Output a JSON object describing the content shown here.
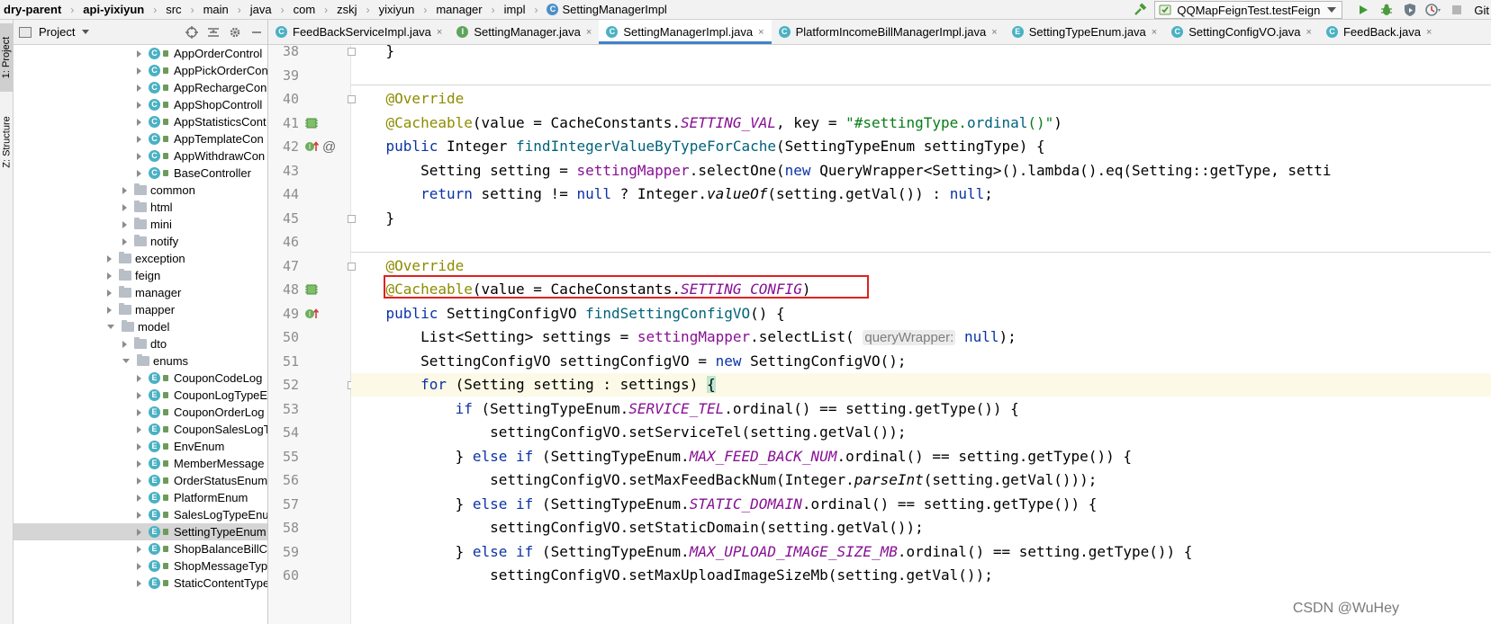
{
  "navbar": {
    "breadcrumbs": [
      "dry-parent",
      "api-yixiyun",
      "src",
      "main",
      "java",
      "com",
      "zskj",
      "yixiyun",
      "manager",
      "impl",
      "SettingManagerImpl"
    ],
    "run_config": "QQMapFeignTest.testFeign",
    "vcs_label": "Git"
  },
  "left_strip": {
    "project_tab": "1: Project",
    "structure_tab": "Z: Structure"
  },
  "project_panel": {
    "title": "Project",
    "tree": [
      {
        "label": "AppOrderControl",
        "type": "class",
        "depth": 3
      },
      {
        "label": "AppPickOrderCon",
        "type": "class",
        "depth": 3
      },
      {
        "label": "AppRechargeCon",
        "type": "class",
        "depth": 3
      },
      {
        "label": "AppShopControll",
        "type": "class",
        "depth": 3
      },
      {
        "label": "AppStatisticsCont",
        "type": "class",
        "depth": 3
      },
      {
        "label": "AppTemplateCon",
        "type": "class",
        "depth": 3
      },
      {
        "label": "AppWithdrawCon",
        "type": "class",
        "depth": 3
      },
      {
        "label": "BaseController",
        "type": "class",
        "depth": 3
      },
      {
        "label": "common",
        "type": "folder",
        "depth": 2
      },
      {
        "label": "html",
        "type": "folder",
        "depth": 2
      },
      {
        "label": "mini",
        "type": "folder",
        "depth": 2
      },
      {
        "label": "notify",
        "type": "folder",
        "depth": 2
      },
      {
        "label": "exception",
        "type": "folder",
        "depth": 1
      },
      {
        "label": "feign",
        "type": "folder",
        "depth": 1
      },
      {
        "label": "manager",
        "type": "folder",
        "depth": 1
      },
      {
        "label": "mapper",
        "type": "folder",
        "depth": 1
      },
      {
        "label": "model",
        "type": "folder-open",
        "depth": 1
      },
      {
        "label": "dto",
        "type": "folder",
        "depth": 2
      },
      {
        "label": "enums",
        "type": "folder-open",
        "depth": 2
      },
      {
        "label": "CouponCodeLog",
        "type": "enum",
        "depth": 3
      },
      {
        "label": "CouponLogTypeE",
        "type": "enum",
        "depth": 3
      },
      {
        "label": "CouponOrderLog",
        "type": "enum",
        "depth": 3
      },
      {
        "label": "CouponSalesLogT",
        "type": "enum",
        "depth": 3
      },
      {
        "label": "EnvEnum",
        "type": "enum",
        "depth": 3
      },
      {
        "label": "MemberMessage",
        "type": "enum",
        "depth": 3
      },
      {
        "label": "OrderStatusEnum",
        "type": "enum",
        "depth": 3
      },
      {
        "label": "PlatformEnum",
        "type": "enum",
        "depth": 3
      },
      {
        "label": "SalesLogTypeEnu",
        "type": "enum",
        "depth": 3
      },
      {
        "label": "SettingTypeEnum",
        "type": "enum",
        "depth": 3,
        "selected": true
      },
      {
        "label": "ShopBalanceBillC",
        "type": "enum",
        "depth": 3
      },
      {
        "label": "ShopMessageTyp",
        "type": "enum",
        "depth": 3
      },
      {
        "label": "StaticContentType",
        "type": "enum",
        "depth": 3
      }
    ]
  },
  "tabs": [
    {
      "label": "FeedBackServiceImpl.java",
      "icon": "c"
    },
    {
      "label": "SettingManager.java",
      "icon": "i"
    },
    {
      "label": "SettingManagerImpl.java",
      "icon": "c",
      "active": true
    },
    {
      "label": "PlatformIncomeBillManagerImpl.java",
      "icon": "c"
    },
    {
      "label": "SettingTypeEnum.java",
      "icon": "e"
    },
    {
      "label": "SettingConfigVO.java",
      "icon": "c"
    },
    {
      "label": "FeedBack.java",
      "icon": "c"
    }
  ],
  "editor": {
    "first_line": 38,
    "current_line": 52,
    "highlighted_line": 48,
    "lines": [
      [
        [
          "    }",
          ""
        ]
      ],
      [
        [
          "",
          ""
        ]
      ],
      [
        [
          "    ",
          ""
        ],
        [
          "@Override",
          "anno"
        ]
      ],
      [
        [
          "    ",
          ""
        ],
        [
          "@Cacheable",
          "anno"
        ],
        [
          "(value = CacheConstants.",
          ""
        ],
        [
          "SETTING_VAL",
          "field"
        ],
        [
          ", key = ",
          ""
        ],
        [
          "\"#settingType.",
          "str"
        ],
        [
          "ordinal",
          "method"
        ],
        [
          "()\"",
          "str"
        ],
        [
          ")",
          ""
        ]
      ],
      [
        [
          "    ",
          ""
        ],
        [
          "public",
          "kw"
        ],
        [
          " Integer ",
          ""
        ],
        [
          "findIntegerValueByTypeForCache",
          "method"
        ],
        [
          "(SettingTypeEnum settingType) {",
          ""
        ]
      ],
      [
        [
          "        Setting setting = ",
          ""
        ],
        [
          "settingMapper",
          "mfield"
        ],
        [
          ".selectOne(",
          ""
        ],
        [
          "new",
          "kw"
        ],
        [
          " QueryWrapper<Setting>().lambda().eq(Setting::getType, setti",
          ""
        ]
      ],
      [
        [
          "        ",
          ""
        ],
        [
          "return",
          "kw"
        ],
        [
          " setting != ",
          ""
        ],
        [
          "null",
          "kw"
        ],
        [
          " ? Integer.",
          ""
        ],
        [
          "valueOf",
          "italic"
        ],
        [
          "(setting.getVal()) : ",
          ""
        ],
        [
          "null",
          "kw"
        ],
        [
          ";",
          ""
        ]
      ],
      [
        [
          "    }",
          ""
        ]
      ],
      [
        [
          "",
          ""
        ]
      ],
      [
        [
          "    ",
          ""
        ],
        [
          "@Override",
          "anno"
        ]
      ],
      [
        [
          "    ",
          ""
        ],
        [
          "@Cacheable",
          "anno"
        ],
        [
          "(value = CacheConstants.",
          ""
        ],
        [
          "SETTING_CONFIG",
          "field"
        ],
        [
          ")",
          ""
        ]
      ],
      [
        [
          "    ",
          ""
        ],
        [
          "public",
          "kw"
        ],
        [
          " SettingConfigVO ",
          ""
        ],
        [
          "findSettingConfigVO",
          "method"
        ],
        [
          "() {",
          ""
        ]
      ],
      [
        [
          "        List<Setting> settings = ",
          ""
        ],
        [
          "settingMapper",
          "mfield"
        ],
        [
          ".selectList( ",
          ""
        ],
        [
          "queryWrapper:",
          "hint"
        ],
        [
          " ",
          ""
        ],
        [
          "null",
          "kw"
        ],
        [
          ");",
          ""
        ]
      ],
      [
        [
          "        SettingConfigVO settingConfigVO = ",
          ""
        ],
        [
          "new",
          "kw"
        ],
        [
          " SettingConfigVO();",
          ""
        ]
      ],
      [
        [
          "        ",
          ""
        ],
        [
          "for",
          "kw"
        ],
        [
          " (Setting setting : settings) ",
          ""
        ],
        [
          "{",
          "brace-hl"
        ]
      ],
      [
        [
          "            ",
          ""
        ],
        [
          "if",
          "kw"
        ],
        [
          " (SettingTypeEnum.",
          ""
        ],
        [
          "SERVICE_TEL",
          "field"
        ],
        [
          ".ordinal() == setting.getType()) {",
          ""
        ]
      ],
      [
        [
          "                settingConfigVO.setServiceTel(setting.getVal());",
          ""
        ]
      ],
      [
        [
          "            } ",
          ""
        ],
        [
          "else if",
          "kw"
        ],
        [
          " (SettingTypeEnum.",
          ""
        ],
        [
          "MAX_FEED_BACK_NUM",
          "field"
        ],
        [
          ".ordinal() == setting.getType()) {",
          ""
        ]
      ],
      [
        [
          "                settingConfigVO.setMaxFeedBackNum(Integer.",
          ""
        ],
        [
          "parseInt",
          "italic"
        ],
        [
          "(setting.getVal()));",
          ""
        ]
      ],
      [
        [
          "            } ",
          ""
        ],
        [
          "else if",
          "kw"
        ],
        [
          " (SettingTypeEnum.",
          ""
        ],
        [
          "STATIC_DOMAIN",
          "field"
        ],
        [
          ".ordinal() == setting.getType()) {",
          ""
        ]
      ],
      [
        [
          "                settingConfigVO.setStaticDomain(setting.getVal());",
          ""
        ]
      ],
      [
        [
          "            } ",
          ""
        ],
        [
          "else if",
          "kw"
        ],
        [
          " (SettingTypeEnum.",
          ""
        ],
        [
          "MAX_UPLOAD_IMAGE_SIZE_MB",
          "field"
        ],
        [
          ".ordinal() == setting.getType()) {",
          ""
        ]
      ],
      [
        [
          "                settingConfigVO.setMaxUploadImageSizeMb(setting.getVal());",
          ""
        ]
      ]
    ]
  },
  "watermark": "CSDN @WuHey",
  "colors": {
    "keyword": "#0b33a6",
    "annotation": "#8d8c00",
    "static_field": "#871094",
    "method": "#00627a",
    "string": "#067d17",
    "highlight_box": "#e02020",
    "active_tab_underline": "#4083c9"
  }
}
